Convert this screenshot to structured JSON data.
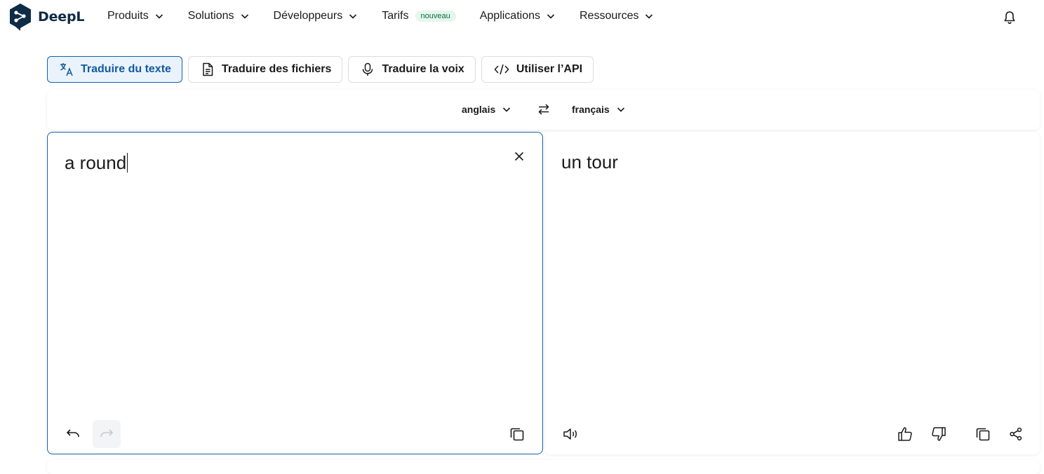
{
  "brand": {
    "name": "DeepL"
  },
  "nav": {
    "items": [
      {
        "label": "Produits",
        "dropdown": true
      },
      {
        "label": "Solutions",
        "dropdown": true
      },
      {
        "label": "Développeurs",
        "dropdown": true
      },
      {
        "label": "Tarifs",
        "dropdown": false,
        "badge": "nouveau"
      },
      {
        "label": "Applications",
        "dropdown": true
      },
      {
        "label": "Ressources",
        "dropdown": true
      }
    ],
    "bell_icon": "bell-icon"
  },
  "tabs": [
    {
      "label": "Traduire du texte",
      "icon": "translate-icon",
      "active": true
    },
    {
      "label": "Traduire des fichiers",
      "icon": "document-icon",
      "active": false
    },
    {
      "label": "Traduire la voix",
      "icon": "microphone-icon",
      "active": false
    },
    {
      "label": "Utiliser l’API",
      "icon": "code-icon",
      "active": false
    }
  ],
  "languages": {
    "source": "anglais",
    "target": "français",
    "swap_icon": "swap-arrows-icon"
  },
  "source_panel": {
    "text": "a round",
    "clear_icon": "close-icon",
    "undo_icon": "undo-icon",
    "redo_icon": "redo-icon",
    "copy_icon": "copy-icon"
  },
  "target_panel": {
    "text": "un tour",
    "speaker_icon": "speaker-icon",
    "thumbs_up_icon": "thumbs-up-icon",
    "thumbs_down_icon": "thumbs-down-icon",
    "copy_icon": "copy-icon",
    "share_icon": "share-icon"
  },
  "colors": {
    "accent": "#0f62ae",
    "brand_navy": "#0f2b46",
    "badge_bg": "#e6f6ee",
    "badge_text": "#0b6b3a"
  }
}
